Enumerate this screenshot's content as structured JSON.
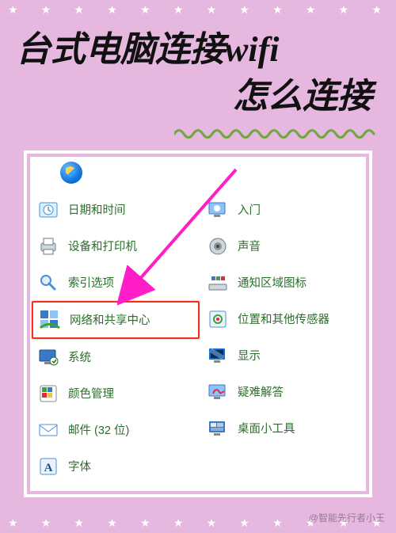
{
  "title": {
    "line1": "台式电脑连接wifi",
    "line2": "怎么连接"
  },
  "panel": {
    "left_items": [
      {
        "id": "datetime",
        "label": "日期和时间",
        "icon": "clock-icon"
      },
      {
        "id": "devices",
        "label": "设备和打印机",
        "icon": "printer-icon"
      },
      {
        "id": "indexing",
        "label": "索引选项",
        "icon": "search-icon"
      },
      {
        "id": "network",
        "label": "网络和共享中心",
        "icon": "network-icon",
        "highlight": true
      },
      {
        "id": "system",
        "label": "系统",
        "icon": "system-icon"
      },
      {
        "id": "color",
        "label": "颜色管理",
        "icon": "color-icon"
      },
      {
        "id": "mail",
        "label": "邮件 (32 位)",
        "icon": "mail-icon"
      },
      {
        "id": "fonts",
        "label": "字体",
        "icon": "font-icon"
      }
    ],
    "right_items": [
      {
        "id": "getting",
        "label": "入门",
        "icon": "getting-started-icon"
      },
      {
        "id": "sound",
        "label": "声音",
        "icon": "speaker-icon"
      },
      {
        "id": "tray",
        "label": "通知区域图标",
        "icon": "tray-icon"
      },
      {
        "id": "sensors",
        "label": "位置和其他传感器",
        "icon": "sensor-icon"
      },
      {
        "id": "display",
        "label": "显示",
        "icon": "display-icon"
      },
      {
        "id": "trouble",
        "label": "疑难解答",
        "icon": "troubleshoot-icon"
      },
      {
        "id": "gadgets",
        "label": "桌面小工具",
        "icon": "gadget-icon"
      }
    ]
  },
  "watermark": "@智能先行者小王"
}
